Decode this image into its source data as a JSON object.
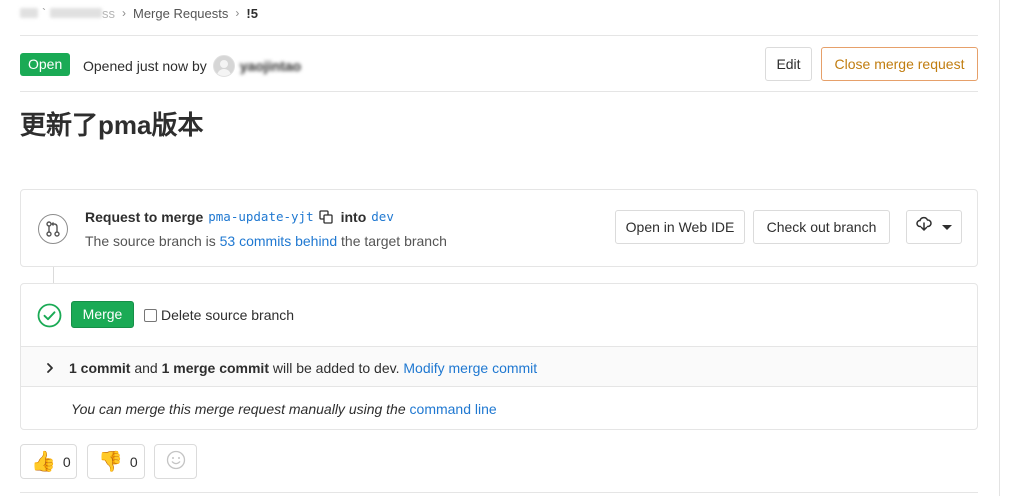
{
  "breadcrumb": {
    "ghost_suffix": "ss",
    "section": "Merge Requests",
    "current": "!5",
    "separator": "›"
  },
  "header": {
    "status": "Open",
    "opened_text": "Opened just now by",
    "author": "yaojintao",
    "edit_label": "Edit",
    "close_label": "Close merge request"
  },
  "title": "更新了pma版本",
  "source_widget": {
    "request_prefix": "Request to merge",
    "source_branch": "pma-update-yjt",
    "into_label": "into",
    "target_branch": "dev",
    "behind_prefix": "The source branch is",
    "behind_link": "53 commits behind",
    "behind_suffix": "the target branch",
    "open_ide_label": "Open in Web IDE",
    "checkout_label": "Check out branch"
  },
  "merge_widget": {
    "merge_label": "Merge",
    "delete_source_label": "Delete source branch",
    "commit_count": "1 commit",
    "and_text": "and",
    "merge_commit_count": "1 merge commit",
    "added_text": "will be added to dev.",
    "modify_link": "Modify merge commit",
    "manual_text": "You can merge this merge request manually using the",
    "command_line_link": "command line"
  },
  "awards": {
    "thumbs_up_emoji": "👍",
    "thumbs_up_count": "0",
    "thumbs_down_emoji": "👎",
    "thumbs_down_count": "0"
  },
  "colors": {
    "success_green": "#1aaa55",
    "link_blue": "#1f78d1",
    "close_orange": "#c17d10"
  }
}
